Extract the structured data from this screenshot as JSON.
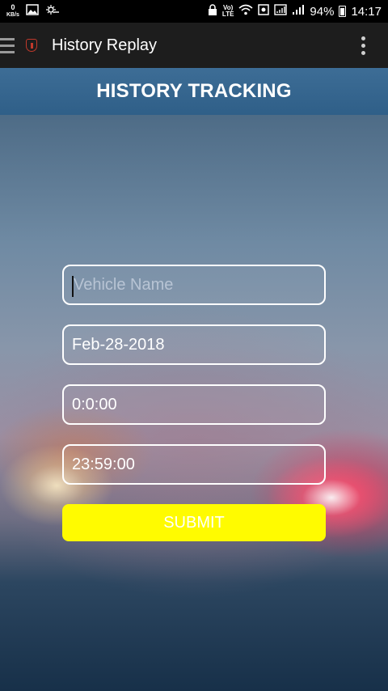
{
  "status_bar": {
    "data_speed": "0",
    "data_unit": "KB/s",
    "network_label_top": "Vo)",
    "network_label_bottom": "LTE",
    "battery": "94%",
    "time": "14:17"
  },
  "app_bar": {
    "title": "History Replay"
  },
  "header": {
    "title": "HISTORY TRACKING"
  },
  "form": {
    "vehicle": {
      "value": "",
      "placeholder": "Vehicle Name"
    },
    "date": {
      "value": "Feb-28-2018"
    },
    "start_time": {
      "value": "0:0:00"
    },
    "end_time": {
      "value": "23:59:00"
    },
    "submit_label": "SUBMIT"
  },
  "colors": {
    "submit_bg": "#fffb00",
    "header_bg": "#3d6d96",
    "appbar_bg": "#1d1d1d"
  }
}
